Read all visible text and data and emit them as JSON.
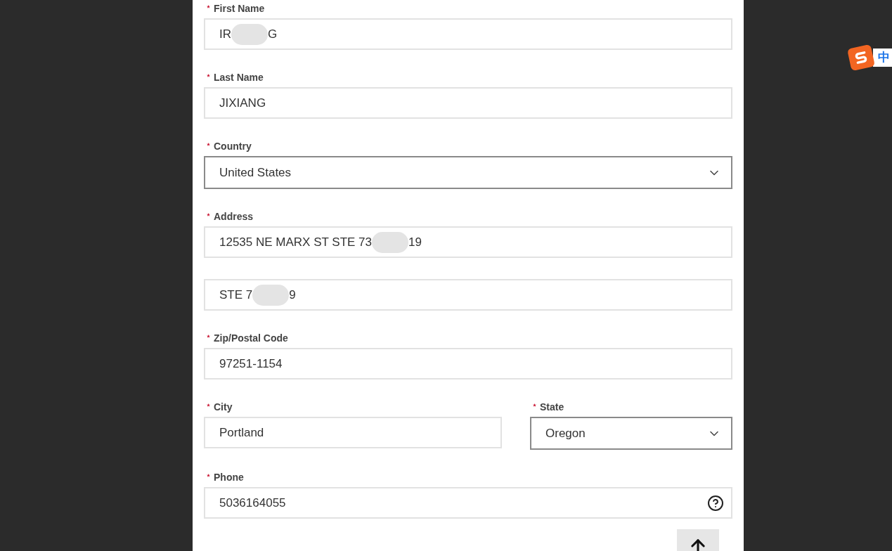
{
  "form": {
    "rows": [
      [
        {
          "label": "First Name",
          "required": true,
          "kind": "text",
          "parts": [
            "IR",
            "G"
          ]
        }
      ],
      [
        {
          "label": "Last Name",
          "required": true,
          "kind": "text",
          "parts": [
            "JIXIANG"
          ]
        }
      ],
      [
        {
          "label": "Country",
          "required": true,
          "kind": "select",
          "parts": [
            "United States"
          ]
        }
      ],
      [
        {
          "label": "Address",
          "required": true,
          "kind": "text",
          "parts": [
            "12535 NE MARX ST STE 73",
            "19"
          ]
        }
      ],
      [
        {
          "kind": "text",
          "parts": [
            "STE 7",
            "9"
          ]
        }
      ],
      [
        {
          "label": "Zip/Postal Code",
          "required": true,
          "kind": "text",
          "parts": [
            "97251-1154"
          ]
        }
      ],
      [
        {
          "label": "City",
          "required": true,
          "kind": "text",
          "parts": [
            "Portland"
          ]
        },
        {
          "label": "State",
          "required": true,
          "kind": "select",
          "parts": [
            "Oregon"
          ]
        }
      ],
      [
        {
          "label": "Phone",
          "required": true,
          "kind": "help",
          "parts": [
            "5036164055"
          ]
        }
      ]
    ]
  },
  "ime": {
    "label": "中"
  }
}
